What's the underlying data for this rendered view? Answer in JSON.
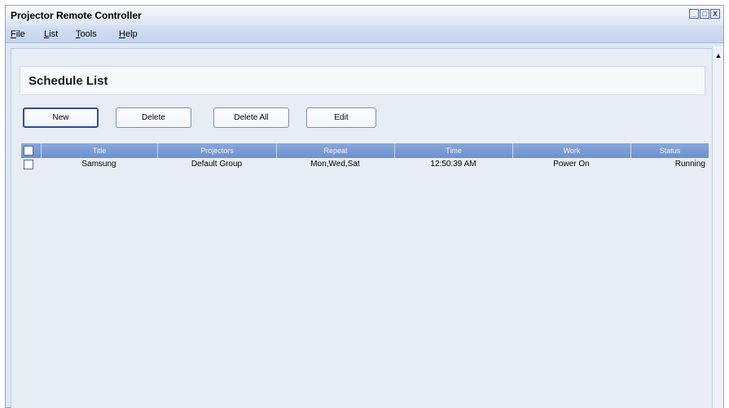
{
  "window": {
    "title": "Projector Remote Controller",
    "buttons": [
      "_",
      "□",
      "X"
    ]
  },
  "menu": [
    {
      "first": "F",
      "rest": "ile"
    },
    {
      "first": "L",
      "rest": "ist"
    },
    {
      "first": "T",
      "rest": "ools"
    },
    {
      "first": "H",
      "rest": "elp"
    }
  ],
  "section": {
    "title": "Schedule List"
  },
  "toolbar": {
    "new": "New",
    "delete": "Delete",
    "delete_all": "Delete All",
    "edit": "Edit"
  },
  "table": {
    "columns": [
      "Title",
      "Projectors",
      "Repeat",
      "Time",
      "Work",
      "Status"
    ],
    "rows": [
      {
        "title": "Samsung",
        "projectors": "Default Group",
        "repeat": "Mon,Wed,Sat",
        "time": "12:50:39 AM",
        "work": "Power On",
        "status": "Running"
      }
    ]
  },
  "scroll": {
    "up_icon": "▲"
  },
  "icons": {
    "minimize": "minimize-icon",
    "maximize": "maximize-icon",
    "close": "close-icon",
    "scroll_up": "scroll-up-arrow-icon"
  },
  "colors": {
    "header_blue": "#6d90cf",
    "background": "#e7ecf5",
    "button_border": "#2b4f9c"
  }
}
